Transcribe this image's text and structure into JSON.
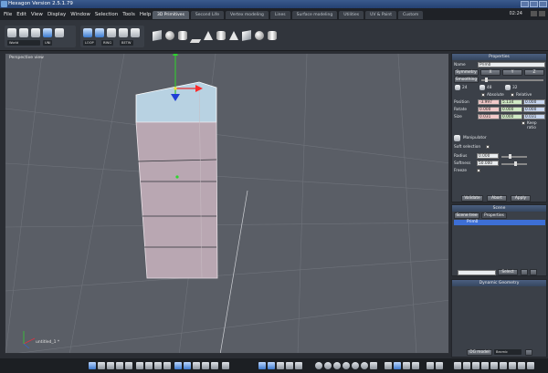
{
  "window": {
    "title": "Hexagon Version 2.5.1.79"
  },
  "menu": [
    "File",
    "Edit",
    "View",
    "Display",
    "Window",
    "Selection",
    "Tools",
    "Help"
  ],
  "tabs": [
    {
      "label": "3D Primitives",
      "active": true
    },
    {
      "label": "Second Life",
      "active": false
    },
    {
      "label": "Vertex modeling",
      "active": false
    },
    {
      "label": "Lines",
      "active": false
    },
    {
      "label": "Surface modeling",
      "active": false
    },
    {
      "label": "Utilities",
      "active": false
    },
    {
      "label": "UV & Paint",
      "active": false
    },
    {
      "label": "Custom",
      "active": false
    }
  ],
  "clock": "02:24",
  "toolbar": {
    "coord_dropdown": "World",
    "sel_labels": [
      "LOOP",
      "RING",
      "BETW"
    ],
    "uni_label": "UNI"
  },
  "viewport": {
    "label": "Perspective view",
    "object_label": "untitled_1 *"
  },
  "properties": {
    "title": "Properties",
    "name_label": "Name",
    "name_value": "Prim0",
    "symmetry_label": "Symmetry",
    "axes": [
      "X",
      "Y",
      "Z"
    ],
    "smoothing_label": "Smoothing",
    "tess_values": [
      "24",
      "48",
      "32"
    ],
    "absolute_label": "Absolute",
    "relative_label": "Relative",
    "position_label": "Position",
    "position": [
      "-3.997",
      "5.134",
      "0.000"
    ],
    "rotate_label": "Rotate",
    "rotate": [
      "0.000",
      "0.000",
      "0.000"
    ],
    "size_label": "Size",
    "size": [
      "0.031",
      "0.000",
      "0.031"
    ],
    "keep_ratio_label": "Keep ratio",
    "manipulator_label": "Manipulator",
    "soft_selection_label": "Soft selection",
    "radius_label": "Radius",
    "radius_value": "0.000",
    "softness_label": "Softness",
    "softness_value": "50.000",
    "freeze_label": "Freeze",
    "buttons": [
      "Validate",
      "Abort",
      "Apply"
    ]
  },
  "scene": {
    "title": "Scene",
    "tabs": [
      "Scene tree",
      "Properties"
    ],
    "item": "Prim0",
    "select_button": "Select"
  },
  "dynamic_geometry": {
    "title": "Dynamic Geometry",
    "mode": "DG model",
    "dropdown": "Bezmic"
  }
}
